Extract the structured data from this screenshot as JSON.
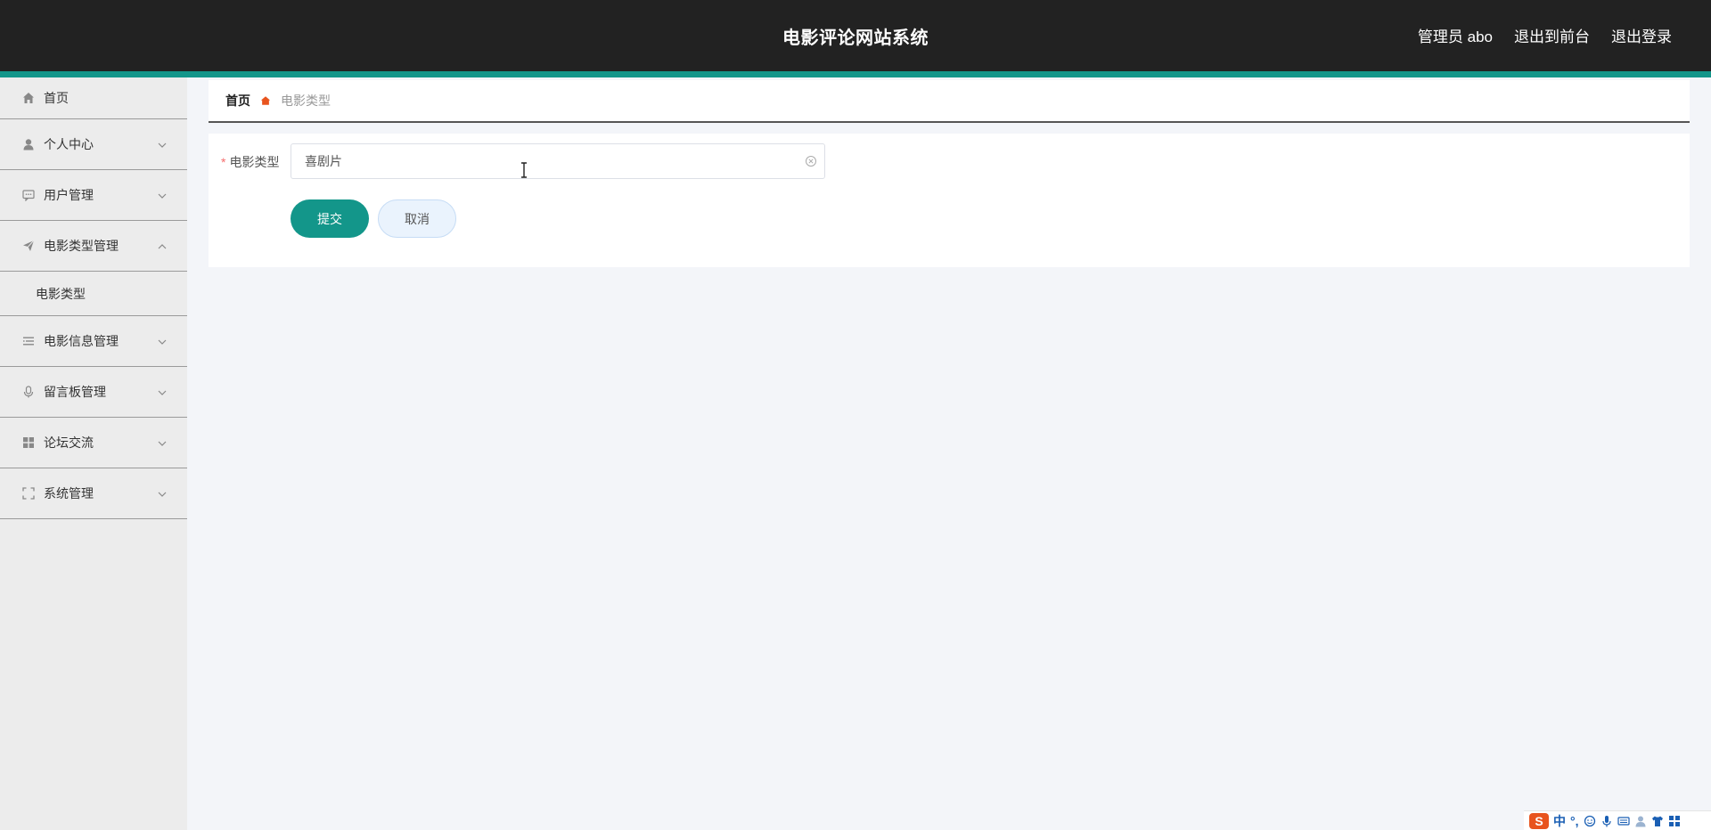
{
  "header": {
    "title": "电影评论网站系统",
    "admin_label": "管理员 abo",
    "front_label": "退出到前台",
    "logout_label": "退出登录",
    "accent_color": "#13968a"
  },
  "sidebar": {
    "items": [
      {
        "label": "首页",
        "icon": "home-icon"
      },
      {
        "label": "个人中心",
        "icon": "user-icon"
      },
      {
        "label": "用户管理",
        "icon": "chat-icon"
      },
      {
        "label": "电影类型管理",
        "icon": "send-icon",
        "expanded": true
      },
      {
        "label": "电影信息管理",
        "icon": "list-icon"
      },
      {
        "label": "留言板管理",
        "icon": "mic-icon"
      },
      {
        "label": "论坛交流",
        "icon": "grid-icon"
      },
      {
        "label": "系统管理",
        "icon": "fullscreen-icon"
      }
    ],
    "sub_item": "电影类型"
  },
  "breadcrumb": {
    "home": "首页",
    "current": "电影类型"
  },
  "form": {
    "field_label": "电影类型",
    "required_mark": "*",
    "field_value": "喜剧片",
    "submit_label": "提交",
    "cancel_label": "取消"
  },
  "ime": {
    "logo": "S",
    "mode": "中",
    "punct": "°,"
  }
}
